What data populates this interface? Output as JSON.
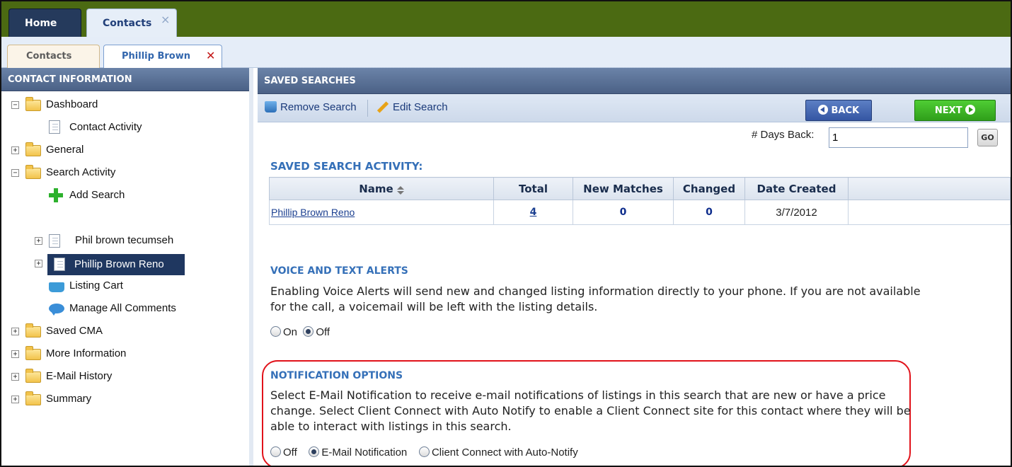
{
  "top_tabs": [
    {
      "label": "Home"
    },
    {
      "label": "Contacts",
      "close": "×"
    }
  ],
  "sub_tabs": [
    {
      "label": "Contacts"
    },
    {
      "label": "Phillip Brown",
      "close": "✕"
    }
  ],
  "left_panel": {
    "title": "CONTACT INFORMATION",
    "tree": [
      {
        "label": "Dashboard",
        "icon": "folder-icon",
        "expander": "−"
      },
      {
        "label": "Contact Activity",
        "icon": "document-icon"
      },
      {
        "label": "General",
        "icon": "folder-icon",
        "expander": "+"
      },
      {
        "label": "Search Activity",
        "icon": "folder-icon",
        "expander": "−"
      },
      {
        "label": "Add Search",
        "icon": "plus-icon"
      },
      {
        "label": "Phil brown tecumseh",
        "icon": "document-icon",
        "expander": "+"
      },
      {
        "label": "Phillip Brown Reno",
        "icon": "document-icon",
        "expander": "+",
        "selected": true
      },
      {
        "label": "Listing Cart",
        "icon": "cart-icon"
      },
      {
        "label": "Manage All Comments",
        "icon": "comment-icon"
      },
      {
        "label": "Saved CMA",
        "icon": "folder-icon",
        "expander": "+"
      },
      {
        "label": "More Information",
        "icon": "folder-icon",
        "expander": "+"
      },
      {
        "label": "E-Mail History",
        "icon": "folder-icon",
        "expander": "+"
      },
      {
        "label": "Summary",
        "icon": "folder-icon",
        "expander": "+"
      }
    ]
  },
  "right_panel": {
    "title": "SAVED SEARCHES",
    "toolbar": {
      "remove_label": "Remove Search",
      "edit_label": "Edit Search",
      "back_label": "BACK",
      "next_label": "NEXT"
    },
    "days_back": {
      "label": "# Days Back:",
      "value": "1",
      "go_label": "GO"
    },
    "activity": {
      "title": "SAVED SEARCH ACTIVITY:",
      "columns": [
        "Name",
        "Total",
        "New Matches",
        "Changed",
        "Date Created"
      ],
      "rows": [
        {
          "name": "Phillip Brown Reno",
          "total": "4",
          "new_matches": "0",
          "changed": "0",
          "date_created": "3/7/2012"
        }
      ]
    },
    "voice_alerts": {
      "title": "VOICE AND TEXT ALERTS",
      "text": "Enabling Voice Alerts will send new and changed listing information directly to your phone. If you are not available for the call, a voicemail will be left with the listing details.",
      "options": [
        {
          "label": "On",
          "selected": false
        },
        {
          "label": "Off",
          "selected": true
        }
      ]
    },
    "notification": {
      "title": "NOTIFICATION OPTIONS",
      "text": "Select E-Mail Notification to receive e-mail notifications of listings in this search that are new or have a price change. Select Client Connect with Auto Notify to enable a Client Connect site for this contact where they will be able to interact with listings in this search.",
      "options": [
        {
          "label": "Off",
          "selected": false
        },
        {
          "label": "E-Mail Notification",
          "selected": true
        },
        {
          "label": "Client Connect with Auto-Notify",
          "selected": false
        }
      ]
    }
  },
  "colors": {
    "topbar": "#4b6a12",
    "header": "#4b6186",
    "accent_link": "#1b3f90",
    "section_title": "#3570b8",
    "highlight_border": "#e1121a"
  }
}
